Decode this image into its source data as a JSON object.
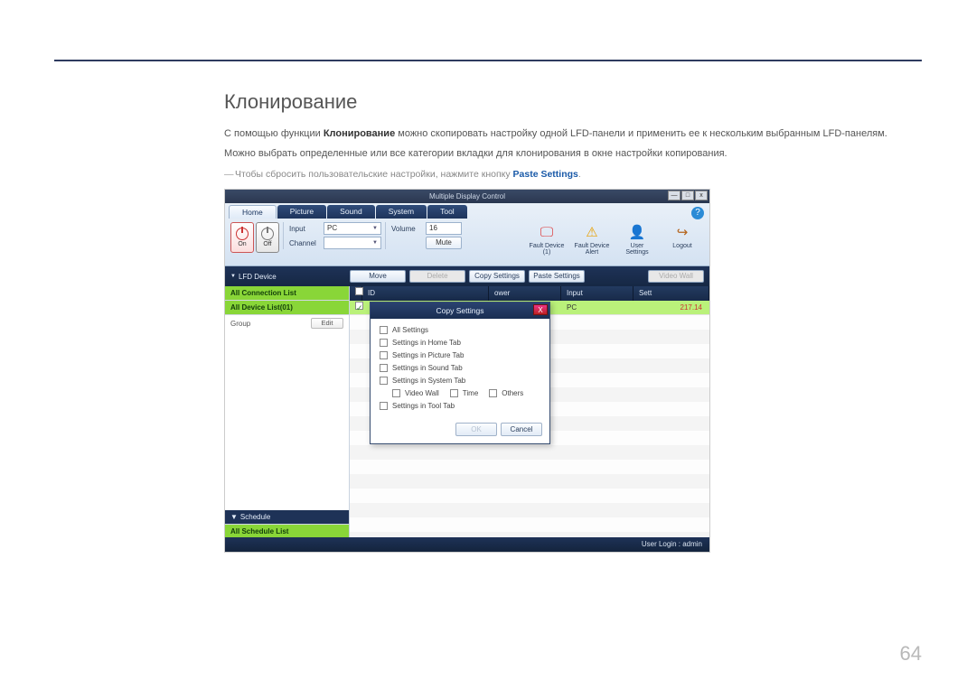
{
  "page_number": "64",
  "section_title": "Клонирование",
  "para1_a": "С помощью функции ",
  "para1_bold": "Клонирование",
  "para1_b": " можно скопировать настройку одной LFD-панели и применить ее к нескольким выбранным LFD-панелям.",
  "para2": "Можно выбрать определенные или все категории вкладки для клонирования в окне настройки копирования.",
  "note_a": "Чтобы сбросить пользовательские настройки, нажмите кнопку ",
  "note_link": "Paste Settings",
  "note_b": ".",
  "app": {
    "title": "Multiple Display Control",
    "win_min": "—",
    "win_max": "□",
    "win_close": "x",
    "tabs": [
      "Home",
      "Picture",
      "Sound",
      "System",
      "Tool"
    ],
    "help": "?",
    "power_on": "On",
    "power_off": "Off",
    "input_label": "Input",
    "channel_label": "Channel",
    "input_value": "PC",
    "volume_label": "Volume",
    "volume_value": "16",
    "mute": "Mute",
    "big": [
      {
        "icon": "🖵",
        "label": "Fault Device (1)"
      },
      {
        "icon": "⚠",
        "label": "Fault Device Alert"
      },
      {
        "icon": "👤",
        "label": "User Settings"
      },
      {
        "icon": "↪",
        "label": "Logout"
      }
    ],
    "sidebar_header": "LFD Device",
    "toolbar": [
      "Move",
      "Delete",
      "Copy Settings",
      "Paste Settings",
      "Video Wall"
    ],
    "side_green1": "All Connection List",
    "side_green2": "All Device List(01)",
    "group_label": "Group",
    "edit": "Edit",
    "schedule_header": "Schedule",
    "side_green3": "All Schedule List",
    "grid_hdr_chk": "",
    "grid_hdr_id": "ID",
    "grid_hdr_pwr": "ower",
    "grid_hdr_input": "Input",
    "grid_hdr_set": "Sett",
    "row_input": "PC",
    "row_set": "217.14",
    "status": "User Login : admin"
  },
  "modal": {
    "title": "Copy Settings",
    "close": "X",
    "opts": [
      "All Settings",
      "Settings in Home Tab",
      "Settings in Picture Tab",
      "Settings in Sound Tab",
      "Settings in System Tab"
    ],
    "sub": [
      "Video Wall",
      "Time",
      "Others"
    ],
    "last": "Settings in Tool Tab",
    "ok": "OK",
    "cancel": "Cancel"
  }
}
